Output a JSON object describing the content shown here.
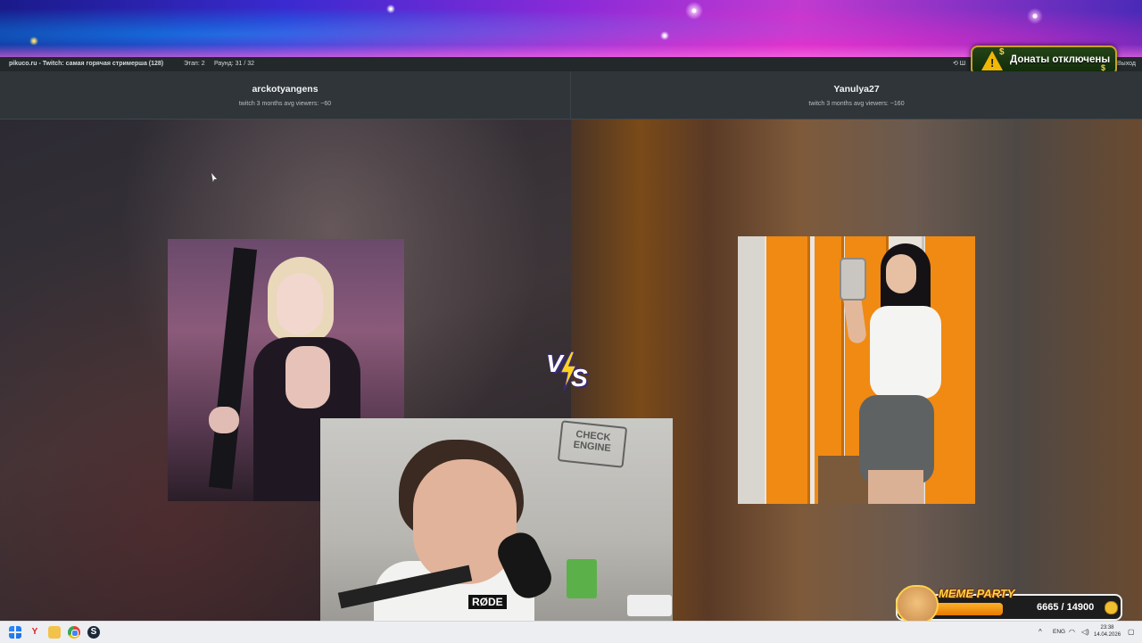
{
  "topbar": {
    "app_title": "pikuco.ru - Twitch: самая горячая стримерша (128)",
    "stage": "Этап: 2",
    "round": "Раунд: 31 / 32",
    "back": "⟲ Ш",
    "exit": "Выход"
  },
  "donations": {
    "label": "Донаты отключены",
    "icon": "warning-icon"
  },
  "left": {
    "name": "arckotyangens",
    "viewers": "twitch 3 months avg viewers: ~60"
  },
  "right": {
    "name": "Yanulya27",
    "viewers": "twitch 3 months avg viewers: ~160"
  },
  "vs": {
    "v": "V",
    "s": "S"
  },
  "webcam": {
    "sign": "CHECK ENGINE",
    "mic_brand": "RØDE"
  },
  "meme_party": {
    "title": "MEME PARTY",
    "count": "6665 / 14900",
    "progress": 0.447
  },
  "taskbar": {
    "yandex": "Y",
    "steam": "S",
    "tray_caret": "^",
    "lang": "ENG",
    "wifi": "◠",
    "volume": "◁)",
    "time": "23:38",
    "date": "14.04.2026",
    "bell": "▢"
  }
}
